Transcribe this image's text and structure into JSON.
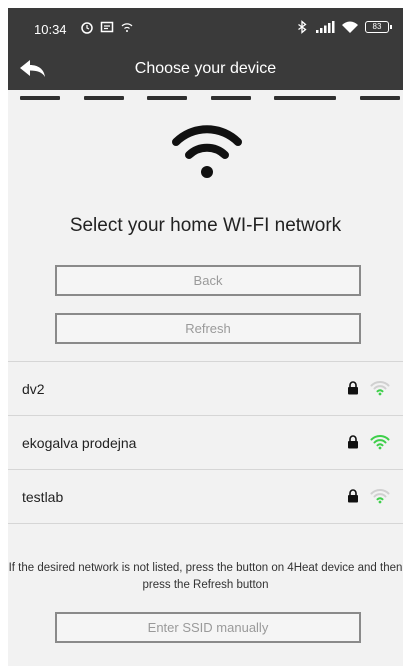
{
  "status_bar": {
    "time": "10:34",
    "battery": "83"
  },
  "app_bar": {
    "title": "Choose your device"
  },
  "heading": "Select your home WI-FI network",
  "buttons": {
    "back": "Back",
    "refresh": "Refresh",
    "ssid_manual": "Enter SSID manually"
  },
  "networks": [
    {
      "name": "dv2",
      "secured": true,
      "signal": "weak"
    },
    {
      "name": "ekogalva prodejna",
      "secured": true,
      "signal": "strong"
    },
    {
      "name": "testlab",
      "secured": true,
      "signal": "weak"
    }
  ],
  "hint": "If the desired network is not listed, press the button on 4Heat device and then press the Refresh button",
  "colors": {
    "bar": "#3a3a3a",
    "background": "#f2f2f2",
    "signal_green": "#3ecf4a",
    "signal_gray": "#d0d0d0"
  }
}
